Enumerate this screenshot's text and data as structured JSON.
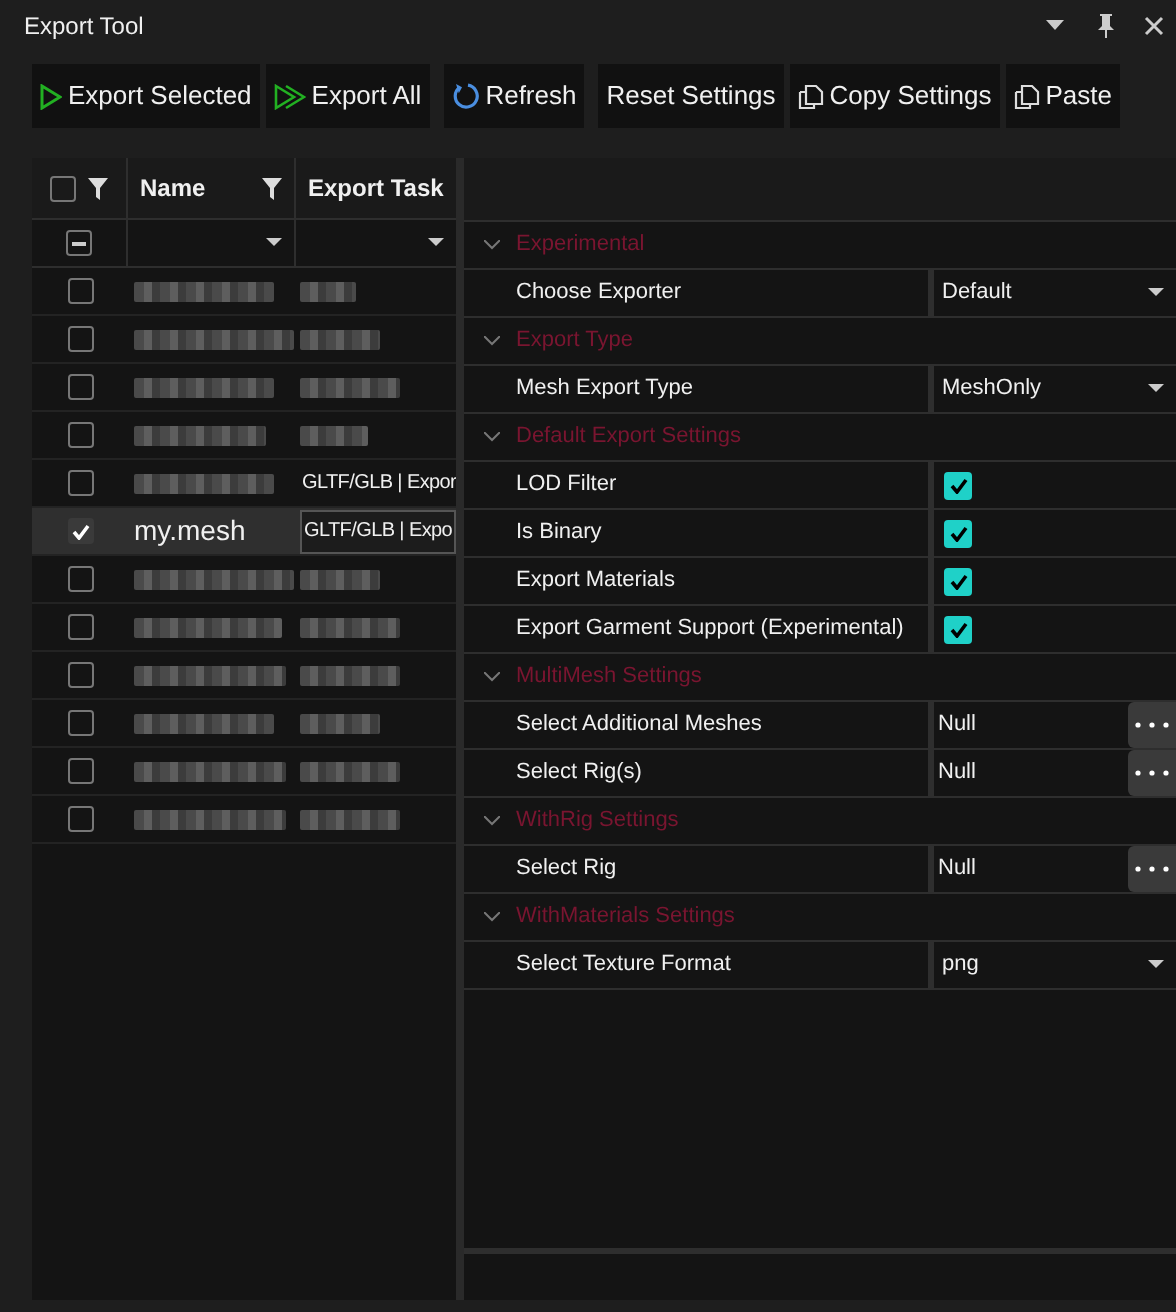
{
  "window": {
    "title": "Export Tool"
  },
  "toolbar": [
    {
      "kind": "play",
      "label": "Export Selected"
    },
    {
      "kind": "playall",
      "label": "Export All"
    },
    {
      "kind": "refresh",
      "label": "Refresh"
    },
    {
      "kind": "plain",
      "label": "Reset Settings"
    },
    {
      "kind": "copy",
      "label": "Copy Settings"
    },
    {
      "kind": "copy",
      "label": "Paste"
    }
  ],
  "grid": {
    "columns": [
      {
        "label": "Name"
      },
      {
        "label": "Export Task"
      }
    ],
    "header_check": {
      "checked": false
    },
    "filter_check": {
      "indeterminate": true
    },
    "rows": [
      {
        "selected": false,
        "checked": false,
        "name": null,
        "export_task": null
      },
      {
        "selected": false,
        "checked": false,
        "name": null,
        "export_task": null
      },
      {
        "selected": false,
        "checked": false,
        "name": null,
        "export_task": null
      },
      {
        "selected": false,
        "checked": false,
        "name": null,
        "export_task": null
      },
      {
        "selected": false,
        "checked": false,
        "name": null,
        "export_task": "GLTF/GLB | Expor"
      },
      {
        "selected": true,
        "checked": true,
        "name": "my.mesh",
        "export_task": "GLTF/GLB | Expo"
      },
      {
        "selected": false,
        "checked": false,
        "name": null,
        "export_task": null
      },
      {
        "selected": false,
        "checked": false,
        "name": null,
        "export_task": null
      },
      {
        "selected": false,
        "checked": false,
        "name": null,
        "export_task": null
      },
      {
        "selected": false,
        "checked": false,
        "name": null,
        "export_task": null
      },
      {
        "selected": false,
        "checked": false,
        "name": null,
        "export_task": null
      },
      {
        "selected": false,
        "checked": false,
        "name": null,
        "export_task": null
      }
    ]
  },
  "properties": [
    {
      "title": "Experimental",
      "expanded": true,
      "items": [
        {
          "kind": "dropdown",
          "label": "Choose Exporter",
          "value": "Default"
        }
      ]
    },
    {
      "title": "Export Type",
      "expanded": true,
      "items": [
        {
          "kind": "dropdown",
          "label": "Mesh Export Type",
          "value": "MeshOnly"
        }
      ]
    },
    {
      "title": "Default Export Settings",
      "expanded": true,
      "items": [
        {
          "kind": "checkbox",
          "label": "LOD Filter",
          "checked": true
        },
        {
          "kind": "checkbox",
          "label": "Is Binary",
          "checked": true
        },
        {
          "kind": "checkbox",
          "label": "Export Materials",
          "checked": true
        },
        {
          "kind": "checkbox",
          "label": "Export Garment Support (Experimental)",
          "checked": true
        }
      ]
    },
    {
      "title": "MultiMesh Settings",
      "expanded": true,
      "items": [
        {
          "kind": "picker",
          "label": "Select Additional Meshes",
          "value": "Null"
        },
        {
          "kind": "picker",
          "label": "Select Rig(s)",
          "value": "Null"
        }
      ]
    },
    {
      "title": "WithRig Settings",
      "expanded": true,
      "items": [
        {
          "kind": "picker",
          "label": "Select Rig",
          "value": "Null"
        }
      ]
    },
    {
      "title": "WithMaterials Settings",
      "expanded": true,
      "items": [
        {
          "kind": "dropdown",
          "label": "Select Texture Format",
          "value": "png"
        }
      ]
    }
  ]
}
